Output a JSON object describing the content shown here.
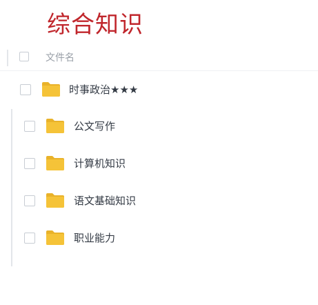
{
  "title": "综合知识",
  "list": {
    "header_label": "文件名",
    "items": [
      {
        "name": "时事政治★★★"
      },
      {
        "name": "公文写作"
      },
      {
        "name": "计算机知识"
      },
      {
        "name": "语文基础知识"
      },
      {
        "name": "职业能力"
      }
    ]
  },
  "colors": {
    "title": "#c0262c",
    "folder": "#f5c338",
    "folder_tab": "#e9b22a"
  },
  "icons": {
    "folder": "folder-icon",
    "checkbox": "checkbox-icon"
  }
}
